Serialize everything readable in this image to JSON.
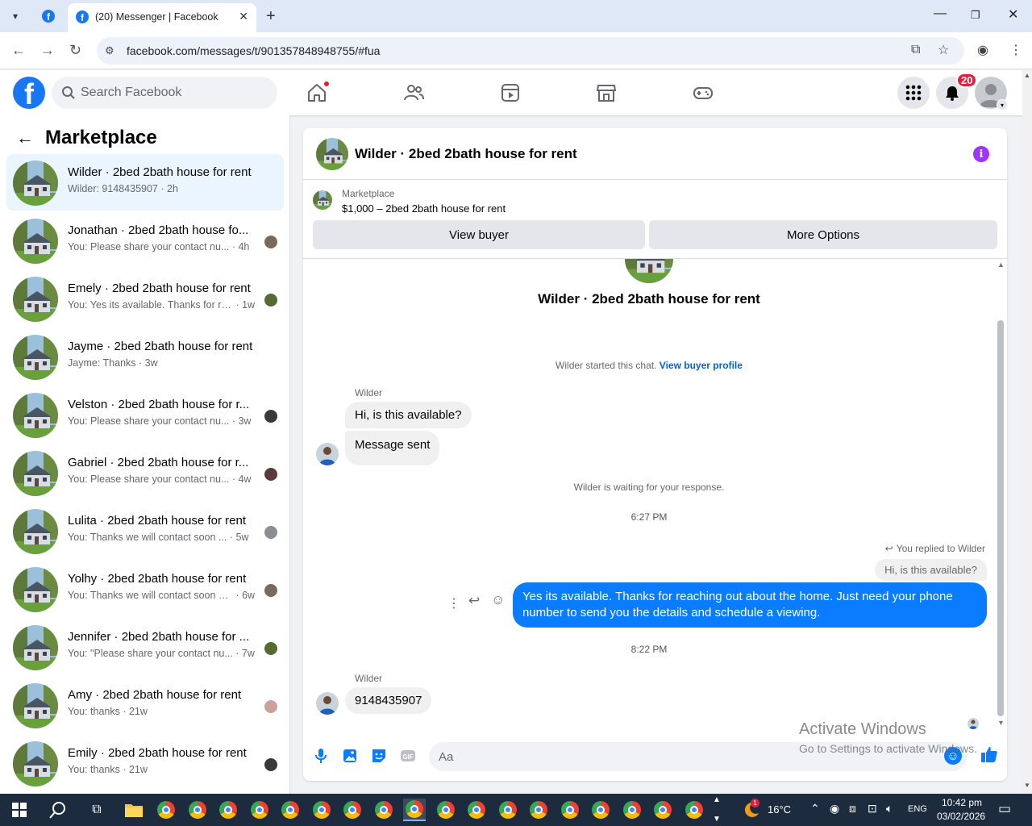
{
  "browser": {
    "tab_title": "(20) Messenger | Facebook",
    "url": "facebook.com/messages/t/901357848948755/#fua"
  },
  "fb": {
    "search_placeholder": "Search Facebook",
    "notif_count": "20"
  },
  "left": {
    "title": "Marketplace",
    "conversations": [
      {
        "name": "Wilder · 2bed 2bath house for rent",
        "preview": "Wilder: 9148435907",
        "time": "2h",
        "active": true
      },
      {
        "name": "Jonathan · 2bed 2bath house fo...",
        "preview": "You: Please share your contact nu...",
        "time": "4h"
      },
      {
        "name": "Emely · 2bed 2bath house for rent",
        "preview": "You: Yes its available. Thanks for reach...",
        "time": "1w"
      },
      {
        "name": "Jayme · 2bed 2bath house for rent",
        "preview": "Jayme: Thanks",
        "time": "3w"
      },
      {
        "name": "Velston · 2bed 2bath house for r...",
        "preview": "You: Please share your contact nu...",
        "time": "3w"
      },
      {
        "name": "Gabriel · 2bed 2bath house for r...",
        "preview": "You: Please share your contact nu...",
        "time": "4w"
      },
      {
        "name": "Lulita · 2bed 2bath house for rent",
        "preview": "You: Thanks we will contact soon ...",
        "time": "5w"
      },
      {
        "name": "Yolhy · 2bed 2bath house for rent",
        "preview": "You: Thanks we will contact soon with...",
        "time": "6w"
      },
      {
        "name": "Jennifer · 2bed 2bath house for ...",
        "preview": "You: \"Please share your contact nu...",
        "time": "7w"
      },
      {
        "name": "Amy · 2bed 2bath house for rent",
        "preview": "You: thanks",
        "time": "21w"
      },
      {
        "name": "Emily · 2bed 2bath house for rent",
        "preview": "You: thanks",
        "time": "21w"
      }
    ]
  },
  "chat": {
    "title": "Wilder · 2bed 2bath house for rent",
    "marketplace_label": "Marketplace",
    "listing": "$1,000 – 2bed 2bath house for rent",
    "view_buyer": "View buyer",
    "more_options": "More Options",
    "intro_title": "Wilder · 2bed 2bath house for rent",
    "started_text": "Wilder started this chat.",
    "view_buyer_profile": "View buyer profile",
    "sender1": "Wilder",
    "msg1": "Hi, is this available?",
    "msg2": "Message sent",
    "waiting": "Wilder is waiting for your response.",
    "time1": "6:27 PM",
    "replied_to": "You replied to Wilder",
    "reply_quote": "Hi, is this available?",
    "outgoing": "Yes its available. Thanks for reaching out about the home. Just need your phone number to send you the details and schedule a viewing.",
    "time2": "8:22 PM",
    "sender2": "Wilder",
    "msg3": "9148435907",
    "composer_placeholder": "Aa"
  },
  "watermark": {
    "line1": "Activate Windows",
    "line2": "Go to Settings to activate Windows."
  },
  "taskbar": {
    "weather": "16°C",
    "lang": "ENG",
    "time": "10:42 pm",
    "date": "03/02/2026"
  },
  "colors": {
    "fb_blue": "#1877f2",
    "messenger_blue": "#0a7cff",
    "notif_red": "#e41e3f"
  }
}
